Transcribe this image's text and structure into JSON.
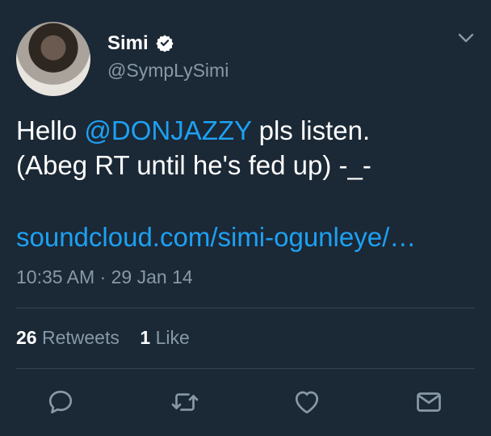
{
  "user": {
    "display_name": "Simi",
    "handle": "@SympLySimi"
  },
  "tweet": {
    "text_before_mention": "Hello ",
    "mention": "@DONJAZZY",
    "text_after_mention": " pls listen.",
    "line2": "(Abeg RT until he's fed up) -_-",
    "link": "soundcloud.com/simi-ogunleye/…",
    "timestamp": "10:35 AM · 29 Jan 14"
  },
  "stats": {
    "retweets_count": "26",
    "retweets_label": "Retweets",
    "likes_count": "1",
    "likes_label": "Like"
  },
  "icons": {
    "verified": "verified-badge-icon",
    "menu": "chevron-down-icon",
    "reply": "reply-icon",
    "retweet": "retweet-icon",
    "like": "heart-icon",
    "dm": "envelope-icon"
  },
  "colors": {
    "background": "#1b2836",
    "accent": "#1da1f2",
    "secondary_text": "#8899a6",
    "divider": "#38444d"
  }
}
